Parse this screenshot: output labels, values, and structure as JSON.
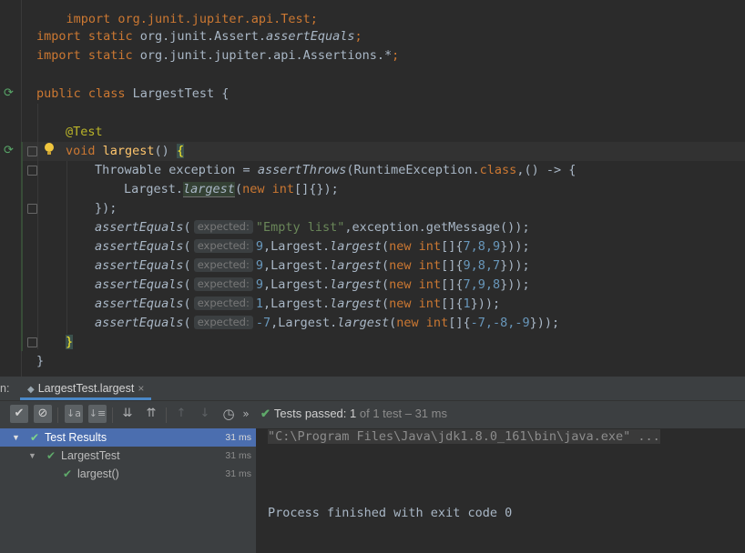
{
  "editor": {
    "lines": {
      "import_junit": "import org.junit.jupiter.api.Test;",
      "l2_kw": "import static ",
      "l2_pkg": "org.junit.Assert.",
      "l2_m": "assertEquals",
      "l2_end": ";",
      "l3_kw": "import static ",
      "l3_pkg": "org.junit.jupiter.api.Assertions.*",
      "l3_end": ";",
      "l4_kw": "public class ",
      "l4_name": "LargestTest {",
      "l5_ann": "@Test",
      "l6_kw": "void ",
      "l6_name": "largest",
      "l6_paren": "() ",
      "l6_brace": "{",
      "l7_a": "Throwable exception = ",
      "l7_m": "assertThrows",
      "l7_b": "(RuntimeException.",
      "l7_kw": "class",
      "l7_c": ",() -> {",
      "l8_a": "Largest.",
      "l8_m": "largest",
      "l8_b": "(",
      "l8_kw": "new int",
      "l8_c": "[]{});",
      "l9": "});",
      "a_m": "assertEquals",
      "a_open": "(",
      "hint": "expected:",
      "a1_str": "\"Empty list\"",
      "a1_rest": ",exception.getMessage());",
      "a2_num": "9",
      "a2_rest_a": ",Largest.",
      "a2_m": "largest",
      "a2_rest_b": "(",
      "a2_kw": "new int",
      "a2_arr": "[]{",
      "a2_vals": "7,8,9",
      "a2_end": "}));",
      "a3_num": "9",
      "a3_vals": "9,8,7",
      "a4_num": "9",
      "a4_vals": "7,9,8",
      "a5_num": "1",
      "a5_vals": "1",
      "a5_end": "}));",
      "a6_num": "-7",
      "a6_vals": "-7,-8,-9",
      "close1": "}",
      "close2": "}"
    }
  },
  "run_panel": {
    "tab_prefix": "n:",
    "tab_label": "LargestTest.largest",
    "tab_close": "×",
    "toolbar": {
      "rerun": "✔",
      "stop": "⊘",
      "sort_alpha": "↓a",
      "sort_dur": "↓≡",
      "expand": "⇊",
      "collapse": "⇈",
      "prev": "↑",
      "next": "↓",
      "history": "◷",
      "more": "»"
    },
    "status": {
      "check": "✔",
      "label": "Tests passed: ",
      "count": "1",
      "rest": " of 1 test – 31 ms"
    },
    "tree": [
      {
        "label": "Test Results",
        "time": "31 ms"
      },
      {
        "label": "LargestTest",
        "time": "31 ms"
      },
      {
        "label": "largest()",
        "time": "31 ms"
      }
    ],
    "console": {
      "command": "\"C:\\Program Files\\Java\\jdk1.8.0_161\\bin\\java.exe\" ...",
      "finished": "Process finished with exit code 0"
    }
  }
}
